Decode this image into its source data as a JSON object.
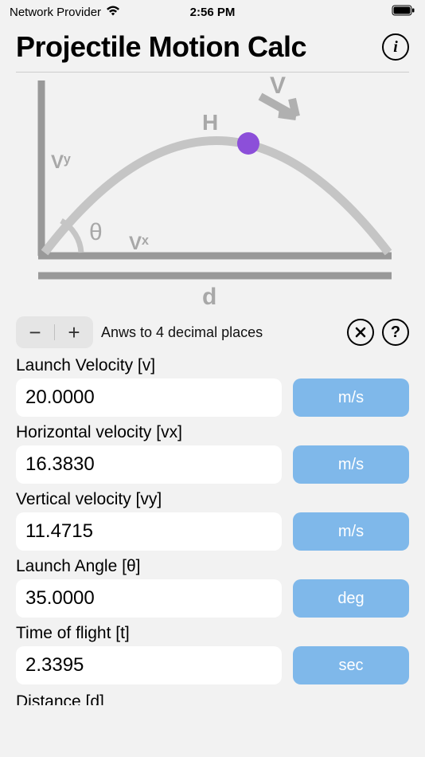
{
  "status_bar": {
    "provider": "Network Provider",
    "time": "2:56 PM"
  },
  "header": {
    "title": "Projectile Motion Calc"
  },
  "diagram": {
    "labels": {
      "V": "V",
      "H": "H",
      "Vy": "Vʸ",
      "Vx": "Vˣ",
      "theta": "θ",
      "d": "d"
    }
  },
  "controls": {
    "minus": "−",
    "plus": "+",
    "precision_text": "Anws to 4 decimal places",
    "clear": "✕",
    "help": "?"
  },
  "fields": [
    {
      "label": "Launch Velocity [v]",
      "value": "20.0000",
      "unit": "m/s"
    },
    {
      "label": "Horizontal velocity [vx]",
      "value": "16.3830",
      "unit": "m/s"
    },
    {
      "label": "Vertical velocity [vy]",
      "value": "11.4715",
      "unit": "m/s"
    },
    {
      "label": "Launch Angle [θ]",
      "value": "35.0000",
      "unit": "deg"
    },
    {
      "label": "Time of flight [t]",
      "value": "2.3395",
      "unit": "sec"
    }
  ],
  "partial_next_label": "Distance [d]"
}
